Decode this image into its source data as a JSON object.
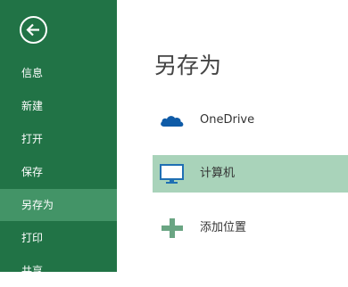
{
  "sidebar": {
    "items": [
      {
        "label": "信息"
      },
      {
        "label": "新建"
      },
      {
        "label": "打开"
      },
      {
        "label": "保存"
      },
      {
        "label": "另存为"
      },
      {
        "label": "打印"
      },
      {
        "label": "共享"
      }
    ],
    "active_index": 4
  },
  "main": {
    "title": "另存为",
    "options": [
      {
        "label": "OneDrive",
        "icon": "cloud-icon"
      },
      {
        "label": "计算机",
        "icon": "computer-icon"
      },
      {
        "label": "添加位置",
        "icon": "plus-icon"
      }
    ],
    "selected_index": 1
  },
  "colors": {
    "sidebar_bg": "#217346",
    "sidebar_active": "#439467",
    "option_selected": "#a9d3ba",
    "onedrive_blue": "#0f5ba7"
  }
}
